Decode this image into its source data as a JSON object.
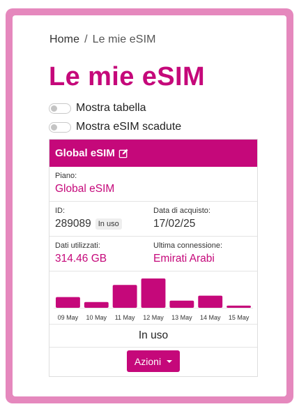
{
  "breadcrumb": {
    "home": "Home",
    "separator": "/",
    "current": "Le mie eSIM"
  },
  "page_title": "Le mie eSIM",
  "toggles": [
    {
      "label": "Mostra tabella",
      "on": false
    },
    {
      "label": "Mostra eSIM scadute",
      "on": false
    }
  ],
  "card": {
    "title": "Global eSIM",
    "edit_icon": "pencil-square-icon",
    "plan_label": "Piano:",
    "plan_value": "Global eSIM",
    "id_label": "ID:",
    "id_value": "289089",
    "id_badge": "In uso",
    "purchase_label": "Data di acquisto:",
    "purchase_value": "17/02/25",
    "data_label": "Dati utilizzati:",
    "data_value": "314.46 GB",
    "last_conn_label": "Ultima connessione:",
    "last_conn_value": "Emirati Arabi",
    "status": "In uso",
    "actions_label": "Azioni"
  },
  "colors": {
    "accent": "#c5087a",
    "frame": "#e588bd"
  },
  "chart_data": {
    "type": "bar",
    "categories": [
      "09 May",
      "10 May",
      "11 May",
      "12 May",
      "13 May",
      "14 May",
      "15 May"
    ],
    "values": [
      15,
      8,
      32,
      41,
      10,
      17,
      3
    ],
    "title": "",
    "xlabel": "",
    "ylabel": ""
  }
}
